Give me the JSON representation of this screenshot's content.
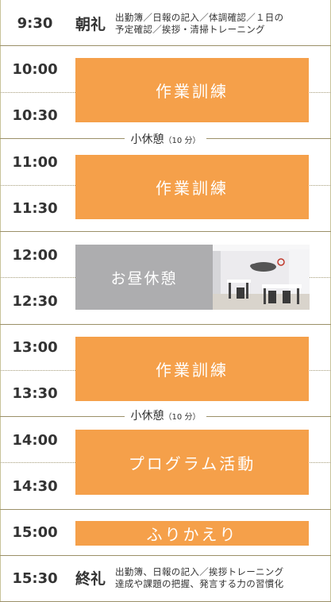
{
  "colors": {
    "accent": "#f5a04a",
    "lunch": "#adadaf",
    "line": "#9b9068"
  },
  "times": {
    "t0930": "9:30",
    "t1000": "10:00",
    "t1030": "10:30",
    "t1100": "11:00",
    "t1130": "11:30",
    "t1200": "12:00",
    "t1230": "12:30",
    "t1300": "13:00",
    "t1330": "13:30",
    "t1400": "14:00",
    "t1430": "14:30",
    "t1500": "15:00",
    "t1530": "15:30"
  },
  "morning": {
    "title": "朝礼",
    "line1": "出勤簿／日報の記入／体調確認／１日の",
    "line2": "予定確認／挨拶・清掃トレーニング"
  },
  "blocks": {
    "training1": "作業訓練",
    "training2": "作業訓練",
    "lunch": "お昼休憩",
    "training3": "作業訓練",
    "program": "プログラム活動",
    "review": "ふりかえり"
  },
  "breaks": {
    "label": "小休憩",
    "duration": "（10 分）"
  },
  "closing": {
    "title": "終礼",
    "line1": "出勤簿、日報の記入／挨拶トレーニング",
    "line2": "達成や課題の把握、発言する力の習慣化"
  },
  "photo": {
    "icon": "office-photo"
  }
}
